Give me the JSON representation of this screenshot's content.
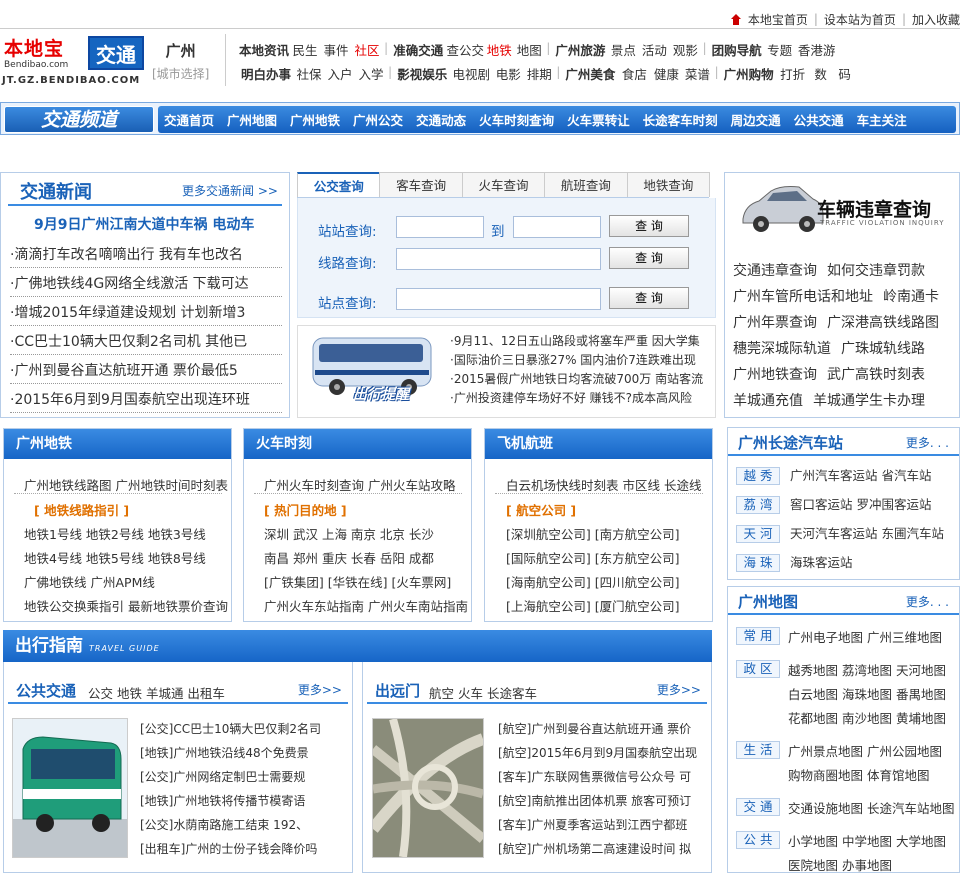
{
  "top_links": {
    "home": "本地宝首页",
    "set_home": "设本站为首页",
    "bookmark": "加入收藏"
  },
  "logo": {
    "brand": "本地宝",
    "brand_sub": "Bendibao.com",
    "channel": "交通",
    "domain": "JT.GZ.BENDIBAO.COM"
  },
  "city": {
    "name": "广州",
    "select": "[城市选择]"
  },
  "nav_row1": [
    "本地资讯",
    "民生",
    "事件",
    "社区",
    "准确交通",
    "查公交",
    "地铁",
    "地图",
    "广州旅游",
    "景点",
    "活动",
    "观影",
    "团购导航",
    "专题",
    "香港游"
  ],
  "nav_row2": [
    "明白办事",
    "社保",
    "入户",
    "入学",
    "影视娱乐",
    "电视剧",
    "电影",
    "排期",
    "广州美食",
    "食店",
    "健康",
    "菜谱",
    "广州购物",
    "打折",
    "数",
    "码"
  ],
  "channel": {
    "title": "交通频道",
    "menu": [
      "交通首页",
      "广州地图",
      "广州地铁",
      "广州公交",
      "交通动态",
      "火车时刻查询",
      "火车票转让",
      "长途客车时刻",
      "周边交通",
      "公共交通",
      "车主关注"
    ]
  },
  "news": {
    "title": "交通新闻",
    "more": "更多交通新闻 >>",
    "headline": "9月9日广州江南大道中车祸  电动车",
    "items": [
      "·滴滴打车改名嘀嘀出行  我有车也改名",
      "·广佛地铁线4G网络全线激活  下载可达",
      "·增城2015年绿道建设规划  计划新增3",
      "·CC巴士10辆大巴仅剩2名司机  其他已",
      "·广州到曼谷直达航班开通  票价最低5",
      "·2015年6月到9月国泰航空出现连环班"
    ]
  },
  "search": {
    "tabs": [
      "公交查询",
      "客车查询",
      "火车查询",
      "航班查询",
      "地铁查询"
    ],
    "station_label": "站站查询:",
    "to_label": "到",
    "line_label": "线路查询:",
    "stop_label": "站点查询:",
    "button": "查  询"
  },
  "remind": {
    "img_label": "出行提醒",
    "items": [
      "·9月11、12日五山路段或将塞车严重  因大学集",
      "·国际油价三日暴涨27%  国内油价7连跌难出现",
      "·2015暑假广州地铁日均客流破700万  南站客流",
      "·广州投资建停车场好不好  赚钱不?成本高风险"
    ]
  },
  "violation": {
    "title": "车辆违章查询",
    "subtitle": "TRAFFIC VIOLATION INQUIRY",
    "links": [
      [
        "交通违章查询",
        "如何交违章罚款"
      ],
      [
        "广州车管所电话和地址",
        "岭南通卡"
      ],
      [
        "广州年票查询",
        "广深港高铁线路图"
      ],
      [
        "穗莞深城际轨道",
        "广珠城轨线路"
      ],
      [
        "广州地铁查询",
        "武广高铁时刻表"
      ],
      [
        "羊城通充值",
        "羊城通学生卡办理"
      ]
    ]
  },
  "metro": {
    "title": "广州地铁",
    "top": "广州地铁线路图  广州地铁时间时刻表",
    "sub": "[  地铁线路指引  ]",
    "rows": [
      "地铁1号线  地铁2号线  地铁3号线",
      "地铁4号线  地铁5号线  地铁8号线",
      "广佛地铁线  广州APM线",
      "地铁公交换乘指引  最新地铁票价查询"
    ]
  },
  "train": {
    "title": "火车时刻",
    "top": "广州火车时刻查询  广州火车站攻略",
    "sub": "[  热门目的地  ]",
    "rows": [
      "深圳  武汉  上海  南京  北京  长沙",
      "南昌  郑州  重庆  长春  岳阳  成都",
      "[广铁集团]  [华铁在线]  [火车票网]",
      "广州火车东站指南  广州火车南站指南"
    ]
  },
  "flight": {
    "title": "飞机航班",
    "top": "白云机场快线时刻表  市区线  长途线",
    "sub": "[  航空公司  ]",
    "rows": [
      "[深圳航空公司]  [南方航空公司]",
      "[国际航空公司]  [东方航空公司]",
      "[海南航空公司]  [四川航空公司]",
      "[上海航空公司]  [厦门航空公司]"
    ]
  },
  "coach": {
    "title": "广州长途汽车站",
    "more": "更多. . .",
    "rows": [
      {
        "tag": "越 秀",
        "text": "广州汽车客运站    省汽车站"
      },
      {
        "tag": "荔 湾",
        "text": "窖口客运站    罗冲围客运站"
      },
      {
        "tag": "天 河",
        "text": "天河汽车客运站    东圃汽车站"
      },
      {
        "tag": "海 珠",
        "text": "海珠客运站"
      }
    ]
  },
  "gzmap": {
    "title": "广州地图",
    "more": "更多. . .",
    "rows": [
      {
        "tag": "常 用",
        "lines": [
          "广州电子地图  广州三维地图"
        ]
      },
      {
        "tag": "政 区",
        "lines": [
          "越秀地图  荔湾地图  天河地图",
          "白云地图  海珠地图  番禺地图",
          "花都地图  南沙地图  黄埔地图"
        ]
      },
      {
        "tag": "生 活",
        "lines": [
          "广州景点地图  广州公园地图",
          "购物商圈地图  体育馆地图"
        ]
      },
      {
        "tag": "交 通",
        "lines": [
          "交通设施地图  长途汽车站地图"
        ]
      },
      {
        "tag": "公 共",
        "lines": [
          "小学地图  中学地图  大学地图",
          "医院地图  办事地图"
        ]
      }
    ]
  },
  "guide": {
    "title": "出行指南",
    "title_en": "TRAVEL GUIDE",
    "public": {
      "title": "公共交通",
      "tags": "公交  地铁  羊城通  出租车",
      "more": "更多>>",
      "items": [
        "[公交]CC巴士10辆大巴仅剩2名司",
        "[地铁]广州地铁沿线48个免费景",
        "[公交]广州网络定制巴士需要规",
        "[地铁]广州地铁将传播节模寄语",
        "[公交]水荫南路施工结束  192、",
        "[出租车]广州的士份子钱会降价吗"
      ]
    },
    "travel": {
      "title": "出远门",
      "tags": "航空  火车  长途客车",
      "more": "更多>>",
      "items": [
        "[航空]广州到曼谷直达航班开通  票价",
        "[航空]2015年6月到9月国泰航空出现",
        "[客车]广东联网售票微信号公众号  可",
        "[航空]南航推出团体机票  旅客可预订",
        "[客车]广州夏季客运站到江西宁都班",
        "[航空]广州机场第二高速建设时间  拟"
      ]
    }
  },
  "colors": {
    "accent": "#1a62b8",
    "bar": "#1665c7",
    "red": "#e60000",
    "orange": "#e07000"
  }
}
